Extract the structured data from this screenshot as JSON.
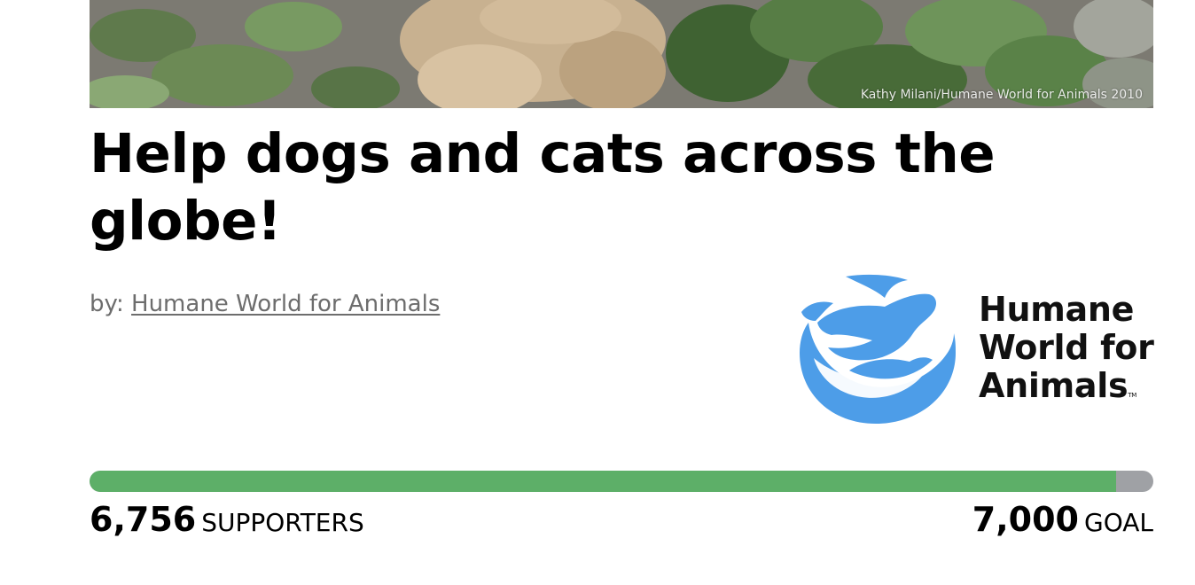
{
  "hero": {
    "photo_credit": "Kathy Milani/Humane World for Animals 2010"
  },
  "campaign": {
    "title": "Help dogs and cats across the globe!",
    "by_prefix": "by:",
    "organization": "Humane World for Animals"
  },
  "logo": {
    "line1": "Humane",
    "line2": "World for",
    "line3": "Animals",
    "trademark": "TM",
    "color": "#4d9de8"
  },
  "progress": {
    "supporters": "6,756",
    "supporters_label": "SUPPORTERS",
    "goal": "7,000",
    "goal_label": "GOAL",
    "fraction": 0.9651,
    "fill_color": "#5daf68",
    "track_color": "#9fa1a5"
  }
}
